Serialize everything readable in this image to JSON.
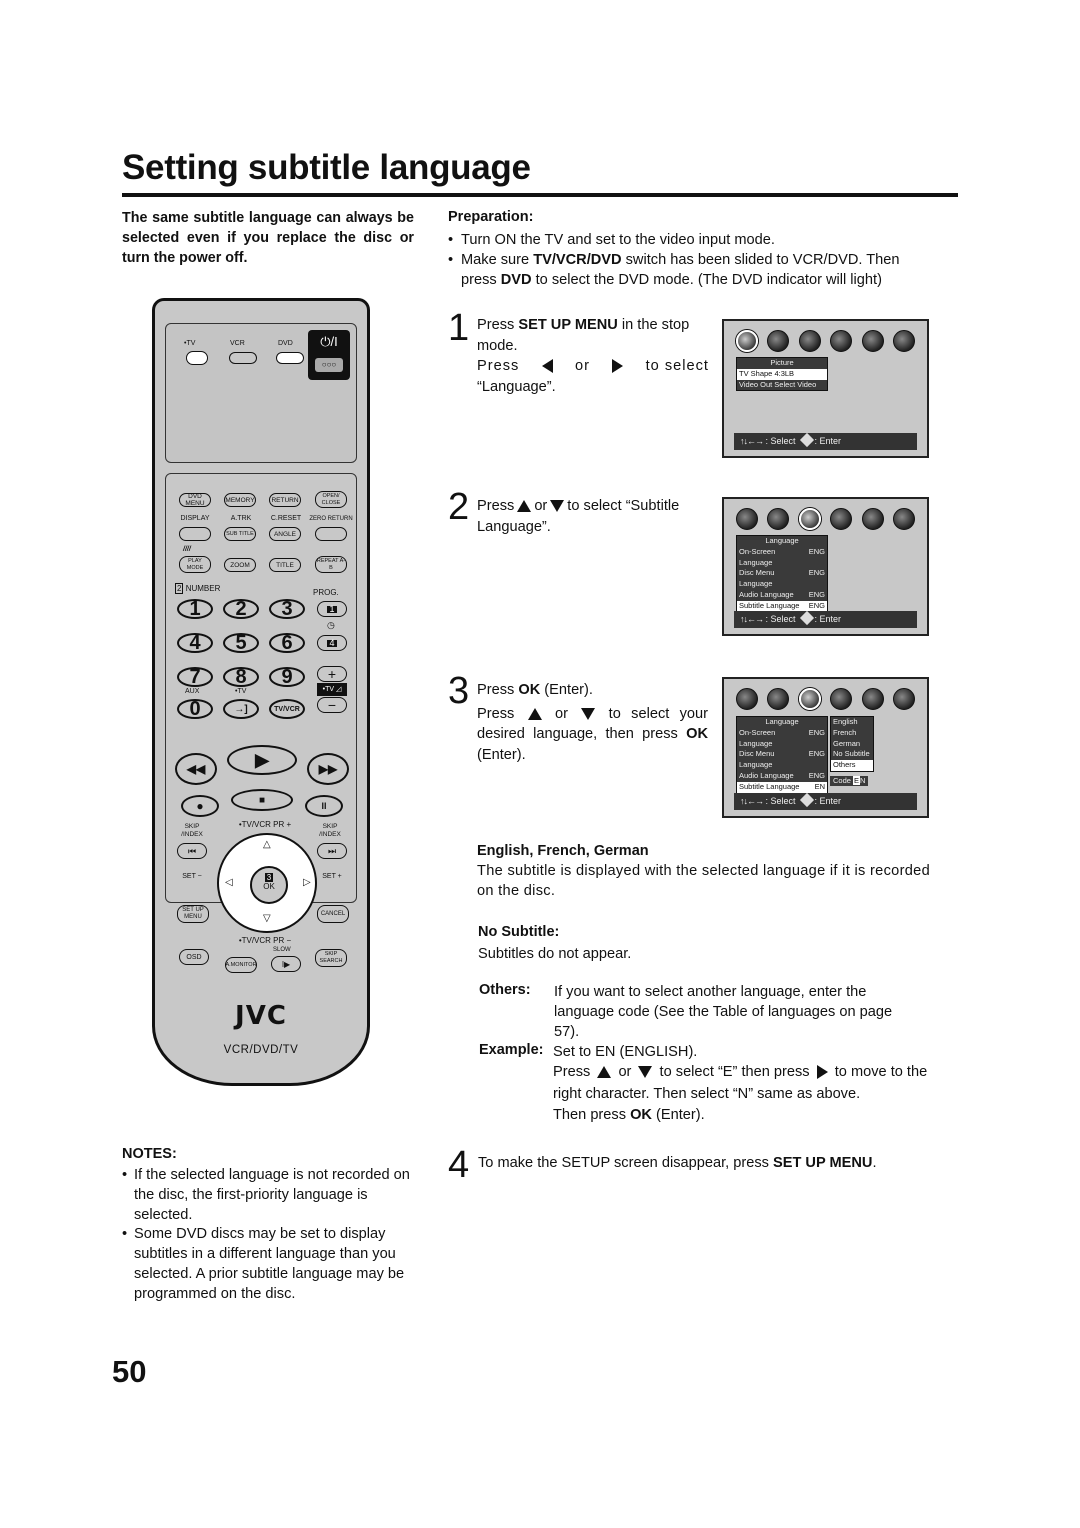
{
  "page": {
    "title": "Setting subtitle language",
    "intro": "The same subtitle language can always be selected even if you replace the disc or turn the power off.",
    "page_number": "50"
  },
  "preparation": {
    "heading": "Preparation:",
    "bullets": [
      {
        "text": "Turn ON the TV and set to the video input mode."
      },
      {
        "pre": "Make sure ",
        "bold1": "TV/VCR/DVD",
        "mid": " switch has been slided to VCR/DVD. Then press ",
        "bold2": "DVD",
        "post": " to select the DVD mode. (The DVD indicator will light)"
      }
    ]
  },
  "steps": [
    {
      "num": "1",
      "a_pre": "Press ",
      "a_bold": "SET UP MENU",
      "a_post": " in the stop mode.",
      "b_pre": "Press",
      "b_or": "or",
      "b_post": "to select",
      "b_last": "“Language”."
    },
    {
      "num": "2",
      "pre": "Press",
      "or": "or",
      "post": "to select “Subtitle Language”."
    },
    {
      "num": "3",
      "a_pre": "Press ",
      "a_bold": "OK",
      "a_post": " (Enter).",
      "b_pre": "Press",
      "b_or": "or",
      "b_post": "to select your desired language, then press ",
      "b_bold": "OK",
      "b_last": " (Enter)."
    },
    {
      "num": "4",
      "pre": "To make the SETUP screen disappear, press ",
      "bold": "SET UP MENU",
      "post": "."
    }
  ],
  "osd": {
    "icons": [
      "picture-icon",
      "audio-icon",
      "language-icon",
      "display-icon",
      "operation-icon",
      "initial-icon"
    ],
    "bar": {
      "arrows": "↑↓←→",
      "select": ": Select",
      "enter": ": Enter"
    },
    "screen1": {
      "header": "Picture",
      "rows": [
        {
          "label": "TV Shape 4:3LB",
          "value": "",
          "highlight": true
        },
        {
          "label": "Video Out Select Video",
          "value": "",
          "highlight": false
        }
      ]
    },
    "screen2": {
      "header": "Language",
      "rows": [
        {
          "label": "On-Screen Language",
          "value": "ENG"
        },
        {
          "label": "Disc Menu Language",
          "value": "ENG"
        },
        {
          "label": "Audio Language",
          "value": "ENG"
        },
        {
          "label": "Subtitle Language",
          "value": "ENG"
        }
      ]
    },
    "screen3": {
      "header": "Language",
      "rows": [
        {
          "label": "On-Screen Language",
          "value": "ENG"
        },
        {
          "label": "Disc Menu Language",
          "value": "ENG"
        },
        {
          "label": "Audio Language",
          "value": "ENG"
        },
        {
          "label": "Subtitle Language",
          "value": "EN"
        }
      ],
      "options": [
        "English",
        "French",
        "German",
        "No Subtitle",
        "Others"
      ],
      "code_label": "Code",
      "code_chars": [
        "E",
        "N"
      ]
    }
  },
  "sections": {
    "efg_heading": "English, French, German",
    "efg_text": "The subtitle is displayed with the selected language if it is recorded on the disc.",
    "nosub_heading": "No Subtitle:",
    "nosub_text": "Subtitles do not appear.",
    "others_label": "Others:",
    "others_text": "If you want to select another language, enter the language code (See the Table of languages on page 57).",
    "example_label": "Example:",
    "example_line1": "Set to EN (ENGLISH).",
    "example_l2_pre": "Press",
    "example_l2_or": "or",
    "example_l2_mid": "to select “E” then press",
    "example_l2_post": "to move to the right character. Then select “N” same as above.",
    "example_l3_pre": "Then press ",
    "example_l3_bold": "OK",
    "example_l3_post": " (Enter)."
  },
  "notes": {
    "heading": "NOTES:",
    "items": [
      "If the selected language is not recorded on the disc, the first-priority language is selected.",
      "Some DVD discs may be set to display subtitles in a different language than you selected. A prior subtitle language may be programmed on the disc."
    ]
  },
  "remote": {
    "switch_labels": {
      "tv": "•TV",
      "vcr": "VCR",
      "dvd": "DVD"
    },
    "power": "⏻/I",
    "power_sub": "○○○",
    "row1": [
      "DVD MENU",
      "MEMORY",
      "RETURN",
      "OPEN/ CLOSE"
    ],
    "row2_labels": [
      "DISPLAY",
      "A.TRK",
      "C.RESET",
      "ZERO RETURN"
    ],
    "row2_buttons": [
      "",
      "SUB TITLE",
      "ANGLE",
      ""
    ],
    "row3_mark": "////",
    "row3": [
      "PLAY MODE",
      "ZOOM",
      "TITLE",
      "REPEAT A-B"
    ],
    "number_label": "NUMBER",
    "number_badge": "2",
    "prog_label": "PROG.",
    "prog_buttons": [
      "1",
      "4"
    ],
    "digits": [
      "1",
      "2",
      "3",
      "4",
      "5",
      "6",
      "7",
      "8",
      "9"
    ],
    "aux_label": "AUX",
    "tv_label": "•TV",
    "zero": "0",
    "input": "→]",
    "tvvcr": "TV/VCR",
    "vol_plus": "+",
    "vol_minus": "−",
    "vol_label": "•TV ◿",
    "play": "▶",
    "rew": "◀◀",
    "ff": "▶▶",
    "rec": "●",
    "stop": "■",
    "pause": "II",
    "skip_label": "SKIP /INDEX",
    "skip_prev": "⏮",
    "skip_next": "⏭",
    "tvvcr_pr_top": "•TV/VCR PR +",
    "tvvcr_pr_bottom": "•TV/VCR PR −",
    "set_minus": "SET −",
    "set_plus": "SET +",
    "ok_badge": "3",
    "ok": "OK",
    "up": "△",
    "down": "▽",
    "left": "◁",
    "right": "▷",
    "setup_menu": "SET UP MENU",
    "cancel": "CANCEL",
    "osd": "OSD",
    "amonitor": "A.MONITOR",
    "slow_label": "SLOW",
    "slow": "I▶",
    "skip_search": "SKIP SEARCH",
    "brand": "JVC",
    "model": "VCR/DVD/TV"
  }
}
